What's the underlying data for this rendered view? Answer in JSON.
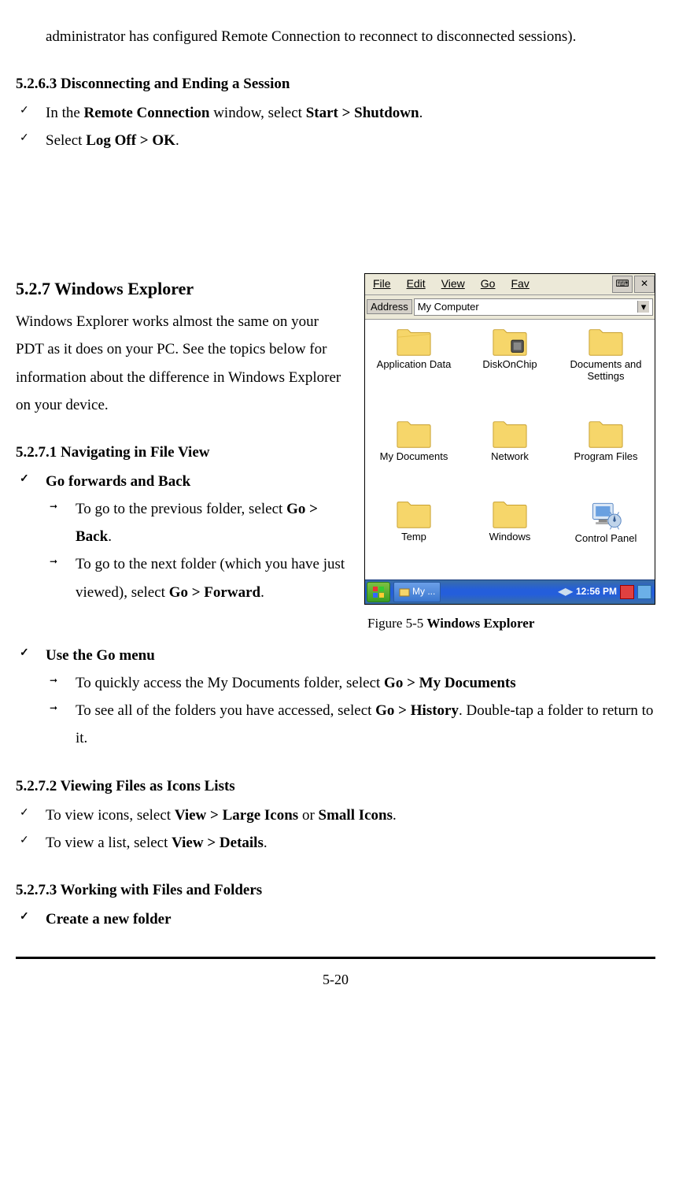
{
  "intro_cont": "administrator has configured Remote Connection to reconnect to disconnected sessions).",
  "s52663": {
    "heading": "5.2.6.3 Disconnecting and Ending a Session",
    "item1_pre": "In the ",
    "item1_b1": "Remote Connection",
    "item1_mid": " window, select ",
    "item1_b2": "Start > Shutdown",
    "item1_post": ".",
    "item2_pre": "Select ",
    "item2_b": "Log Off > OK",
    "item2_post": "."
  },
  "s527": {
    "heading": "5.2.7 Windows Explorer",
    "para": "Windows Explorer works almost the same on your PDT as it does on your PC. See the topics below for information about the difference in Windows Explorer on your device."
  },
  "s5271": {
    "heading": "5.2.7.1 Navigating in File View",
    "goFB": "Go forwards and Back",
    "back_pre": "To go to the previous folder, select ",
    "back_b": "Go > Back",
    "back_post": ".",
    "fwd_pre": "To go to the next folder (which you have just viewed), select ",
    "fwd_b": "Go > Forward",
    "fwd_post": ".",
    "useGo": "Use the Go menu",
    "mydocs_pre": "To quickly access the My Documents folder, select ",
    "mydocs_b": "Go > My Documents",
    "hist_pre": "To see all of the folders you have accessed, select ",
    "hist_b": "Go > History",
    "hist_post": ". Double-tap a folder to return to it."
  },
  "s5272": {
    "heading": "5.2.7.2 Viewing Files as Icons Lists",
    "icons_pre": "To view icons, select ",
    "icons_b1": "View > Large Icons",
    "icons_mid": " or ",
    "icons_b2": "Small Icons",
    "icons_post": ".",
    "list_pre": "To view a list, select ",
    "list_b": "View > Details",
    "list_post": "."
  },
  "s5273": {
    "heading": "5.2.7.3 Working with Files and Folders",
    "create": "Create a new folder"
  },
  "figure": {
    "menu": {
      "file": "File",
      "edit": "Edit",
      "view": "View",
      "go": "Go",
      "fav": "Fav"
    },
    "address_label": "Address",
    "address_value": "My Computer",
    "icons": {
      "r1c1": "Application Data",
      "r1c2": "DiskOnChip",
      "r1c3": "Documents and Settings",
      "r2c1": "My Documents",
      "r2c2": "Network",
      "r2c3": "Program Files",
      "r3c1": "Temp",
      "r3c2": "Windows",
      "r3c3": "Control Panel"
    },
    "taskbar": {
      "app": "My ...",
      "time": "12:56 PM"
    },
    "caption_pre": "Figure 5-5 ",
    "caption_b": "Windows Explorer"
  },
  "page_number": "5-20"
}
